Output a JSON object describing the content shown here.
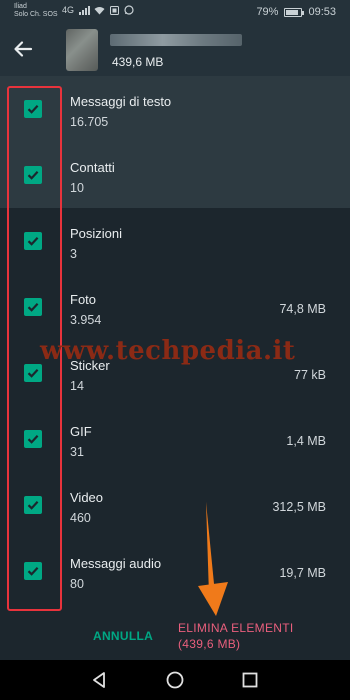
{
  "status_bar": {
    "carrier_line1": "Iliad",
    "carrier_line2": "Solo Ch. SOS",
    "network": "4G",
    "battery": "79%",
    "battery_level": 0.79,
    "time": "09:53"
  },
  "header": {
    "total_size": "439,6 MB",
    "back_icon": "arrow-left-icon"
  },
  "items": [
    {
      "title": "Messaggi di testo",
      "count": "16.705",
      "size": "",
      "checked": true
    },
    {
      "title": "Contatti",
      "count": "10",
      "size": "",
      "checked": true
    },
    {
      "title": "Posizioni",
      "count": "3",
      "size": "",
      "checked": true
    },
    {
      "title": "Foto",
      "count": "3.954",
      "size": "74,8 MB",
      "checked": true
    },
    {
      "title": "Sticker",
      "count": "14",
      "size": "77 kB",
      "checked": true
    },
    {
      "title": "GIF",
      "count": "31",
      "size": "1,4 MB",
      "checked": true
    },
    {
      "title": "Video",
      "count": "460",
      "size": "312,5 MB",
      "checked": true
    },
    {
      "title": "Messaggi audio",
      "count": "80",
      "size": "19,7 MB",
      "checked": true
    }
  ],
  "actions": {
    "cancel_label": "ANNULLA",
    "delete_label_line1": "ELIMINA ELEMENTI",
    "delete_label_line2": "(439,6 MB)"
  },
  "watermark": "www.techpedia.it",
  "colors": {
    "accent": "#00a884",
    "danger": "#ea5f7d",
    "annotation_red": "#e8333c",
    "annotation_arrow": "#f07a1a"
  }
}
